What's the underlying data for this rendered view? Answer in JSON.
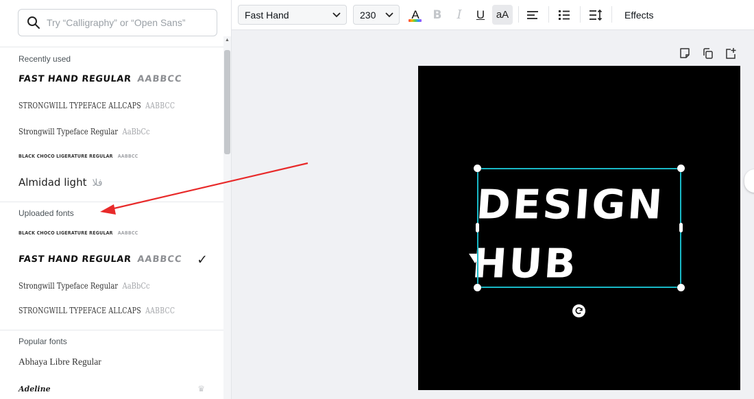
{
  "search": {
    "placeholder": "Try “Calligraphy” or “Open Sans”"
  },
  "sections": {
    "recent": "Recently used",
    "uploaded": "Uploaded fonts",
    "popular": "Popular fonts"
  },
  "recent_fonts": [
    {
      "name": "FAST HAND REGULAR",
      "sample": "AABBCC"
    },
    {
      "name": "STRONGWILL TYPEFACE ALLCAPS",
      "sample": "AABBCC"
    },
    {
      "name": "Strongwill Typeface Regular",
      "sample": "AaBbCc"
    },
    {
      "name": "BLACK CHOCO LIGERATURE REGULAR",
      "sample": "AABBCC"
    },
    {
      "name": "Almidad light",
      "sample": "فلا"
    }
  ],
  "uploaded_fonts": [
    {
      "name": "BLACK CHOCO LIGERATURE REGULAR",
      "sample": "AABBCC"
    },
    {
      "name": "FAST HAND REGULAR",
      "sample": "AABBCC",
      "selected": true
    },
    {
      "name": "Strongwill Typeface Regular",
      "sample": "AaBbCc"
    },
    {
      "name": "STRONGWILL TYPEFACE ALLCAPS",
      "sample": "AABBCC"
    }
  ],
  "popular_fonts": [
    {
      "name": "Abhaya Libre Regular"
    },
    {
      "name": "Adeline",
      "premium": true
    }
  ],
  "toolbar": {
    "font_name": "Fast Hand",
    "font_size": "230",
    "text_color_label": "A",
    "bold_label": "B",
    "italic_label": "I",
    "underline_label": "U",
    "case_label": "aA",
    "effects_label": "Effects"
  },
  "canvas": {
    "line1": "DESIGN",
    "line2": "HUB",
    "background": "#000000",
    "text_color": "#ffffff",
    "selection_color": "#18b8c6"
  },
  "annotation": {
    "arrow_color": "#e82a2a"
  },
  "icons": {
    "search": "search-icon",
    "check": "check-icon",
    "crown": "crown-icon",
    "align": "align-left-icon",
    "list": "bullet-list-icon",
    "spacing": "line-spacing-icon",
    "note": "note-icon",
    "duplicate": "duplicate-icon",
    "add_page": "add-page-icon",
    "rotate": "rotate-icon"
  }
}
